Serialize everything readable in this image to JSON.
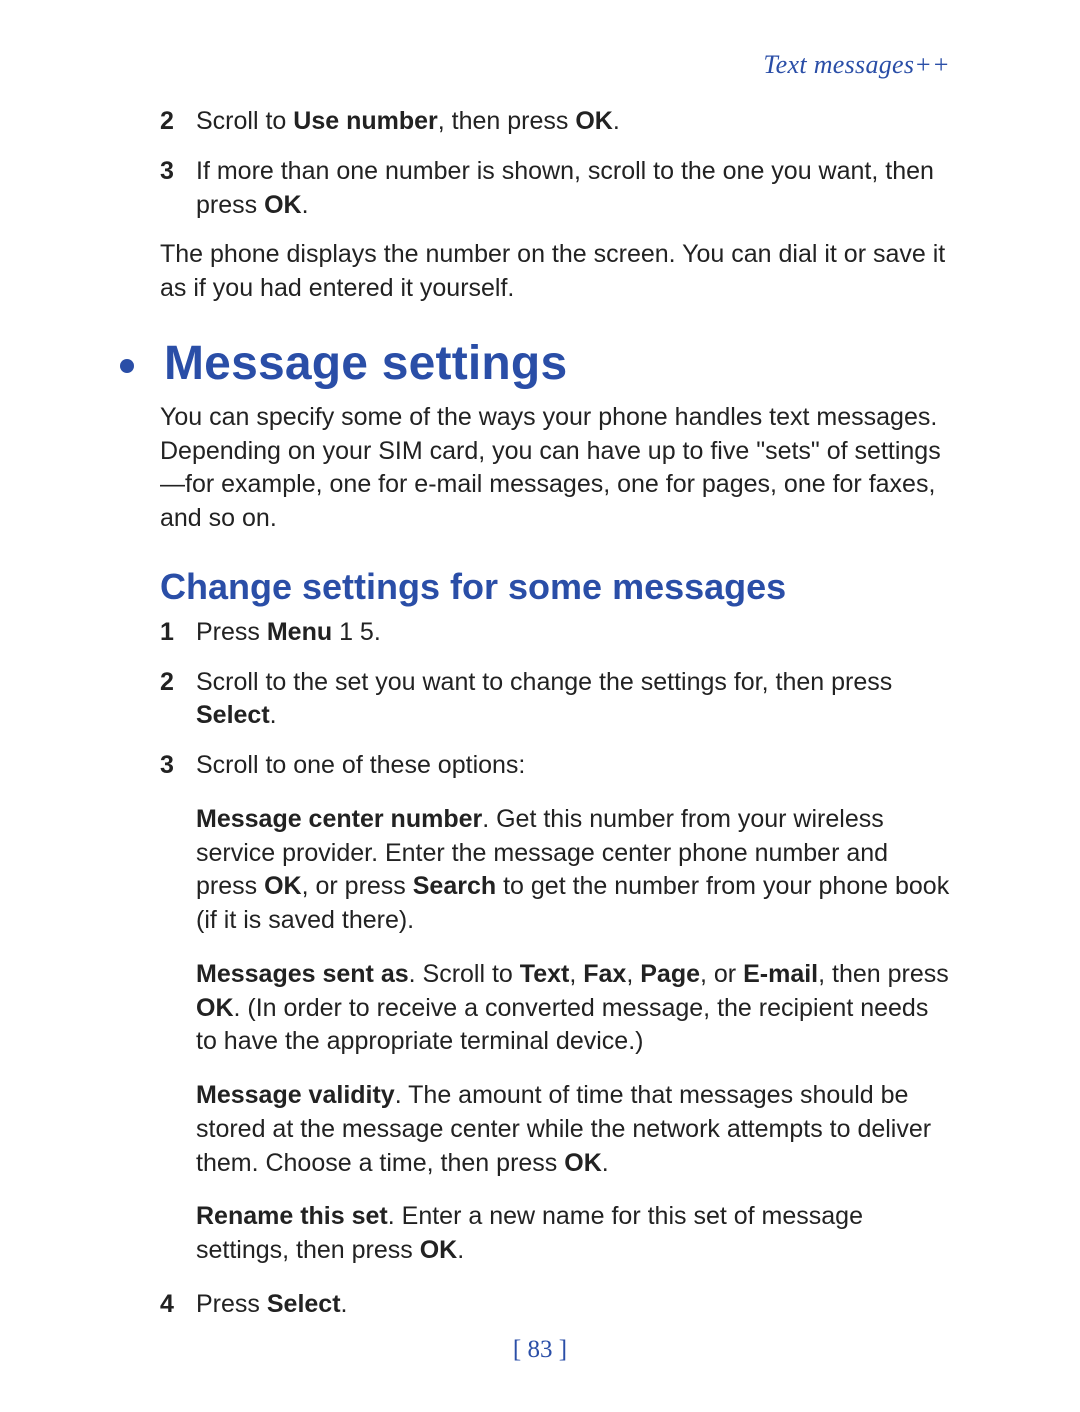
{
  "header": {
    "running_title": "Text messages++"
  },
  "pre_steps": [
    {
      "n": "2",
      "parts": [
        {
          "t": "Scroll to ",
          "b": false
        },
        {
          "t": "Use number",
          "b": true
        },
        {
          "t": ", then press ",
          "b": false
        },
        {
          "t": "OK",
          "b": true
        },
        {
          "t": ".",
          "b": false
        }
      ]
    },
    {
      "n": "3",
      "parts": [
        {
          "t": "If more than one number is shown, scroll to the one you want, then press ",
          "b": false
        },
        {
          "t": "OK",
          "b": true
        },
        {
          "t": ".",
          "b": false
        }
      ]
    }
  ],
  "pre_paragraph": "The phone displays the number on the screen. You can dial it or save it as if you had entered it yourself.",
  "section": {
    "title": "Message settings",
    "intro": "You can specify some of the ways your phone handles text messages. Depending on your SIM card, you can have up to five \"sets\" of settings—for example, one for e-mail messages, one for pages, one for faxes, and so on."
  },
  "subsection": {
    "title": "Change settings for some messages",
    "steps": [
      {
        "n": "1",
        "parts": [
          {
            "t": "Press ",
            "b": false
          },
          {
            "t": "Menu",
            "b": true
          },
          {
            "t": " 1 5.",
            "b": false
          }
        ]
      },
      {
        "n": "2",
        "parts": [
          {
            "t": "Scroll to the set you want to change the settings for, then press ",
            "b": false
          },
          {
            "t": "Select",
            "b": true
          },
          {
            "t": ".",
            "b": false
          }
        ]
      },
      {
        "n": "3",
        "parts": [
          {
            "t": "Scroll to one of these options:",
            "b": false
          }
        ]
      }
    ],
    "options": [
      {
        "parts": [
          {
            "t": "Message center number",
            "b": true
          },
          {
            "t": ". Get this number from your wireless service provider. Enter the message center phone number and press ",
            "b": false
          },
          {
            "t": "OK",
            "b": true
          },
          {
            "t": ", or press ",
            "b": false
          },
          {
            "t": "Search",
            "b": true
          },
          {
            "t": " to get the number from your phone book (if it is saved there).",
            "b": false
          }
        ]
      },
      {
        "parts": [
          {
            "t": "Messages sent as",
            "b": true
          },
          {
            "t": ". Scroll to ",
            "b": false
          },
          {
            "t": "Text",
            "b": true
          },
          {
            "t": ", ",
            "b": false
          },
          {
            "t": "Fax",
            "b": true
          },
          {
            "t": ", ",
            "b": false
          },
          {
            "t": "Page",
            "b": true
          },
          {
            "t": ", or ",
            "b": false
          },
          {
            "t": "E-mail",
            "b": true
          },
          {
            "t": ", then press ",
            "b": false
          },
          {
            "t": "OK",
            "b": true
          },
          {
            "t": ". (In order to receive a converted message, the recipient needs to have the appropriate terminal device.)",
            "b": false
          }
        ]
      },
      {
        "parts": [
          {
            "t": "Message validity",
            "b": true
          },
          {
            "t": ". The amount of time that messages should be stored at the message center while the network attempts to deliver them. Choose a time, then press ",
            "b": false
          },
          {
            "t": "OK",
            "b": true
          },
          {
            "t": ".",
            "b": false
          }
        ]
      },
      {
        "parts": [
          {
            "t": "Rename this set",
            "b": true
          },
          {
            "t": ". Enter a new name for this set of message settings, then press ",
            "b": false
          },
          {
            "t": "OK",
            "b": true
          },
          {
            "t": ".",
            "b": false
          }
        ]
      }
    ],
    "final_step": {
      "n": "4",
      "parts": [
        {
          "t": "Press ",
          "b": false
        },
        {
          "t": "Select",
          "b": true
        },
        {
          "t": ".",
          "b": false
        }
      ]
    }
  },
  "page_number": "[ 83 ]"
}
